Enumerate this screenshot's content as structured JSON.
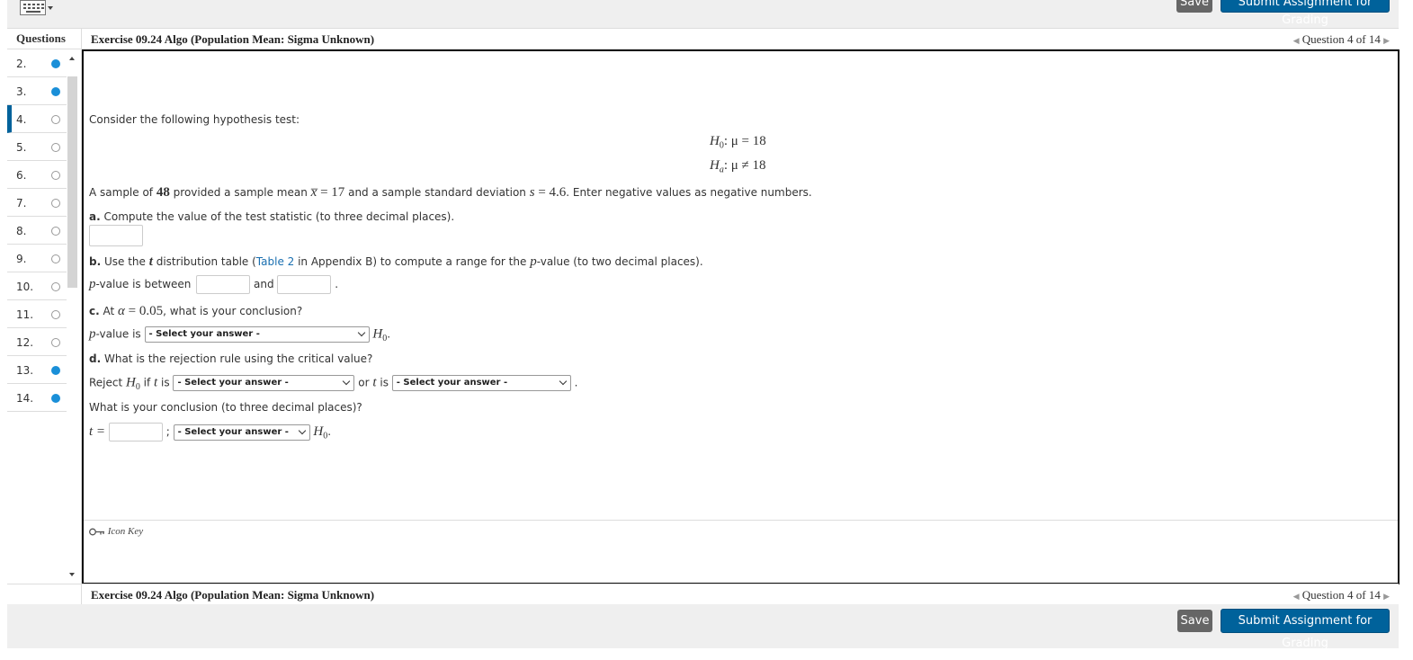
{
  "toolbar": {
    "save_label": "Save",
    "submit_label": "Submit Assignment for Grading",
    "keyboard_icon": "keyboard-icon"
  },
  "header": {
    "questions_label": "Questions",
    "title": "Exercise 09.24 Algo (Population Mean: Sigma Unknown)",
    "nav_text": "Question 4 of 14"
  },
  "sidebar": {
    "items": [
      {
        "num": "2.",
        "status": "answered"
      },
      {
        "num": "3.",
        "status": "answered"
      },
      {
        "num": "4.",
        "status": "unanswered",
        "current": true
      },
      {
        "num": "5.",
        "status": "unanswered"
      },
      {
        "num": "6.",
        "status": "unanswered"
      },
      {
        "num": "7.",
        "status": "unanswered"
      },
      {
        "num": "8.",
        "status": "unanswered"
      },
      {
        "num": "9.",
        "status": "unanswered"
      },
      {
        "num": "10.",
        "status": "unanswered"
      },
      {
        "num": "11.",
        "status": "unanswered"
      },
      {
        "num": "12.",
        "status": "unanswered"
      },
      {
        "num": "13.",
        "status": "answered"
      },
      {
        "num": "14.",
        "status": "answered"
      }
    ]
  },
  "question": {
    "intro": "Consider the following hypothesis test:",
    "h0_label": "H",
    "h0_sub": "0",
    "h0_rel": ": μ = 18",
    "ha_label": "H",
    "ha_sub": "a",
    "ha_rel": ": μ ≠ 18",
    "sample_pre": "A sample of ",
    "n": "48",
    "sample_mid1": " provided a sample mean ",
    "xbar": "x̅",
    "eq1": " = 17",
    "sample_mid2": " and a sample standard deviation ",
    "s": "s",
    "eq2": " = 4.6",
    "sample_post": ". Enter negative values as negative numbers.",
    "a_label": "a.",
    "a_text": " Compute the value of the test statistic (to three decimal places).",
    "b_label": "b.",
    "b_text1": " Use the ",
    "t": "t",
    "b_text2": " distribution table (",
    "b_link": "Table 2",
    "b_text3": " in Appendix B) to compute a range for the ",
    "p": "p",
    "b_text4": "-value (to two decimal places).",
    "pvalue_between": "-value is between",
    "and": "and",
    "period": ".",
    "c_label": "c.",
    "c_text1": " At ",
    "alpha": "α",
    "c_eq": " = 0.05",
    "c_text2": ", what is your conclusion?",
    "pvalue_is": "-value is",
    "d_label": "d.",
    "d_text": " What is the rejection rule using the critical value?",
    "reject": "Reject ",
    "if": " if ",
    "is": " is",
    "or": "or ",
    "conclusion_q": "What is your conclusion (to three decimal places)?",
    "t_eq": "t =",
    "semicolon": ";",
    "select_placeholder": "- Select your answer -",
    "icon_key": "Icon Key"
  },
  "colors": {
    "brand": "#00629b",
    "answered_dot": "#1a8fd8",
    "save": "#666666",
    "link": "#1a6fb0"
  }
}
